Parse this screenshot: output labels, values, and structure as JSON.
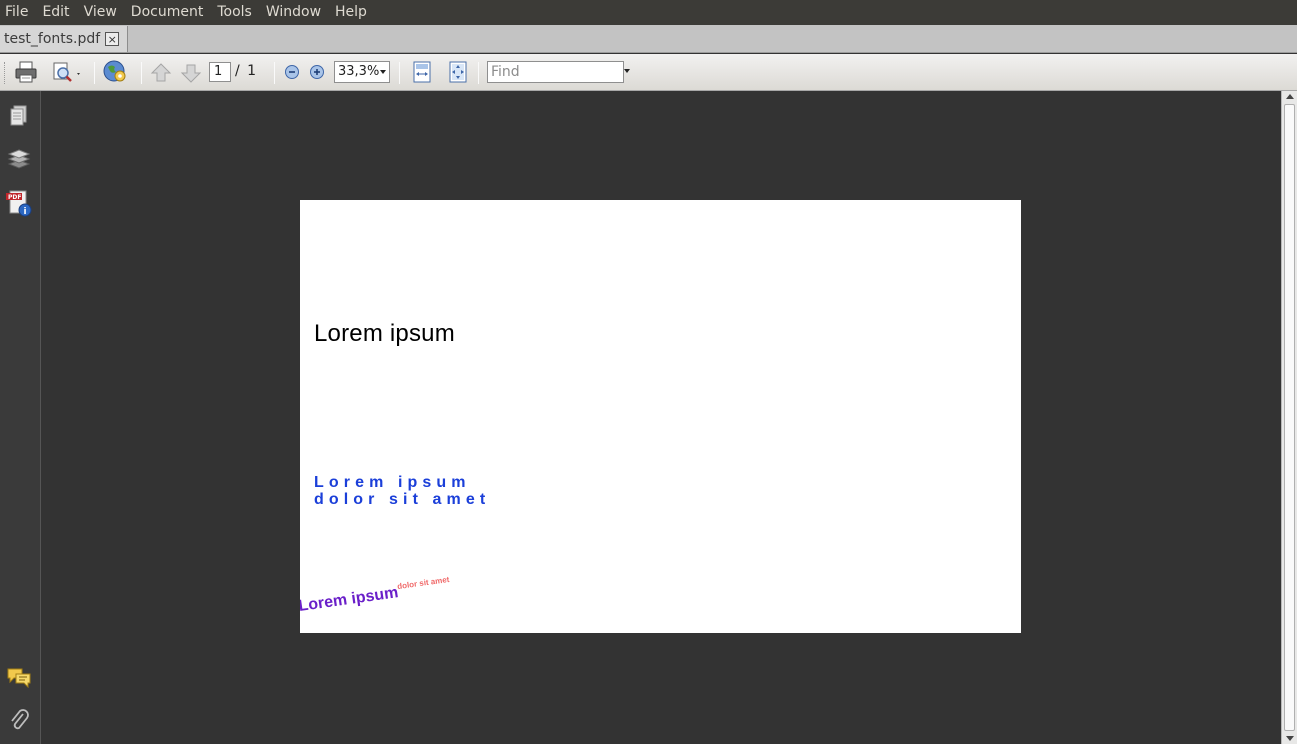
{
  "menubar": {
    "items": [
      "File",
      "Edit",
      "View",
      "Document",
      "Tools",
      "Window",
      "Help"
    ]
  },
  "tab": {
    "label": "test_fonts.pdf",
    "close_glyph": "×"
  },
  "toolbar": {
    "current_page": "1",
    "page_total": "/ 1",
    "zoom": "33,3%",
    "find_placeholder": "Find",
    "icons": [
      "print-icon",
      "print-preview-icon",
      "earth-gear-icon",
      "arrow-up-icon",
      "arrow-down-icon",
      "zoom-out-icon",
      "zoom-in-icon",
      "fit-width-icon",
      "fit-page-icon"
    ]
  },
  "sidebar": {
    "icons": [
      "pages-icon",
      "layers-icon",
      "pdf-info-icon",
      "comments-icon",
      "attachment-icon"
    ]
  },
  "document": {
    "text1": "Lorem ipsum",
    "text2_line1": "Lorem ipsum",
    "text2_line2": "dolor sit amet",
    "text3": "Lorem ipsum",
    "text4": "dolor sit amet"
  }
}
